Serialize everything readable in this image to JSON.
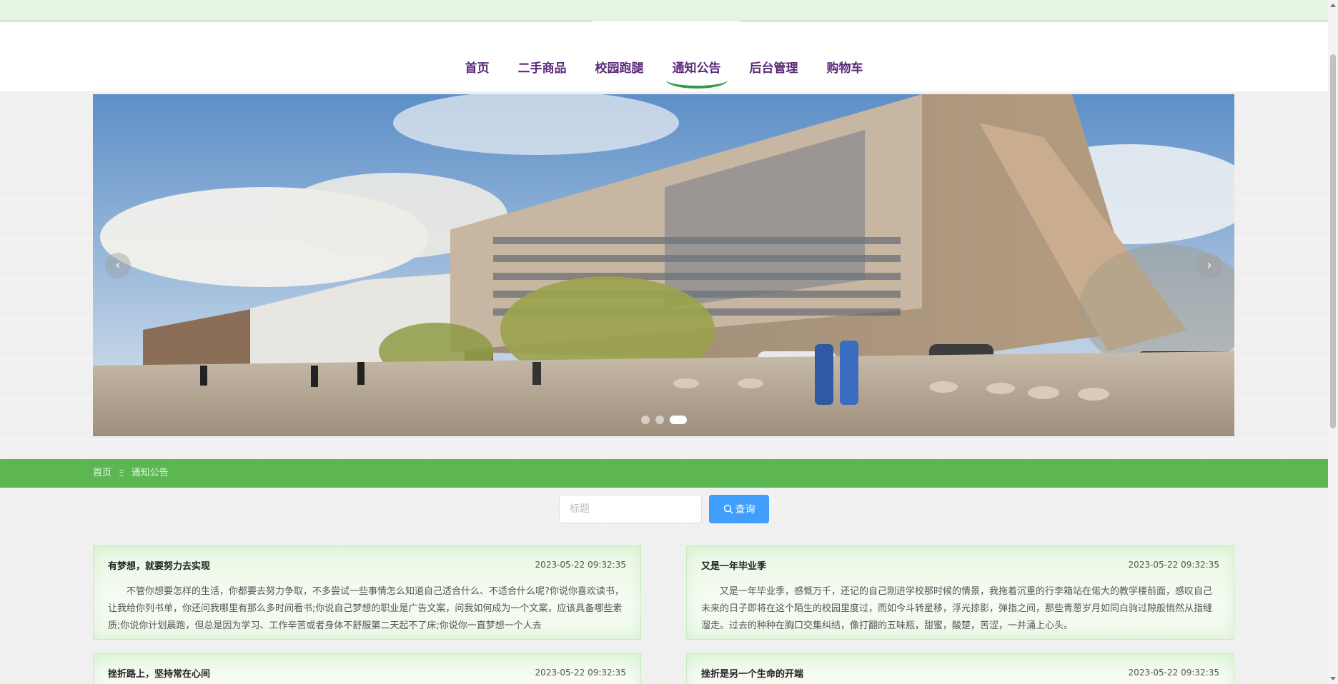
{
  "nav": {
    "items": [
      {
        "label": "首页"
      },
      {
        "label": "二手商品"
      },
      {
        "label": "校园跑腿"
      },
      {
        "label": "通知公告",
        "active": true
      },
      {
        "label": "后台管理"
      },
      {
        "label": "购物车"
      }
    ]
  },
  "banner": {
    "prev_icon": "‹",
    "next_icon": "›",
    "slide_count": 3,
    "active_slide": 3
  },
  "breadcrumb": {
    "home": "首页",
    "separator": "Ξ",
    "current": "通知公告"
  },
  "search": {
    "placeholder": "标题",
    "button_label": "查询"
  },
  "notices": [
    {
      "title": "有梦想，就要努力去实现",
      "time": "2023-05-22 09:32:35",
      "content": "不管你想要怎样的生活，你都要去努力争取，不多尝试一些事情怎么知道自己适合什么、不适合什么呢?你说你喜欢读书，让我给你列书单，你还问我哪里有那么多时间看书;你说自己梦想的职业是广告文案，问我如何成为一个文案，应该具备哪些素质;你说你计划晨跑，但总是因为学习、工作辛苦或者身体不舒服第二天起不了床;你说你一直梦想一个人去"
    },
    {
      "title": "又是一年毕业季",
      "time": "2023-05-22 09:32:35",
      "content": "又是一年毕业季，感慨万千，还记的自己刚进学校那时候的情景，我拖着沉重的行李箱站在偌大的教学楼前面，感叹自己未来的日子即将在这个陌生的校园里度过，而如今斗转星移，浮光掠影，弹指之间，那些青葱岁月如同白驹过隙般悄然从指缝溜走。过去的种种在胸口交集纠结，像打翻的五味瓶，甜蜜，酸楚，苦涩，一并涌上心头。"
    },
    {
      "title": "挫折路上，坚持常在心间",
      "time": "2023-05-22 09:32:35",
      "content": ""
    },
    {
      "title": "挫折是另一个生命的开端",
      "time": "2023-05-22 09:32:35",
      "content": ""
    }
  ],
  "colors": {
    "nav_text": "#5a2a7a",
    "accent_green": "#5cb753",
    "search_button": "#409eff"
  }
}
